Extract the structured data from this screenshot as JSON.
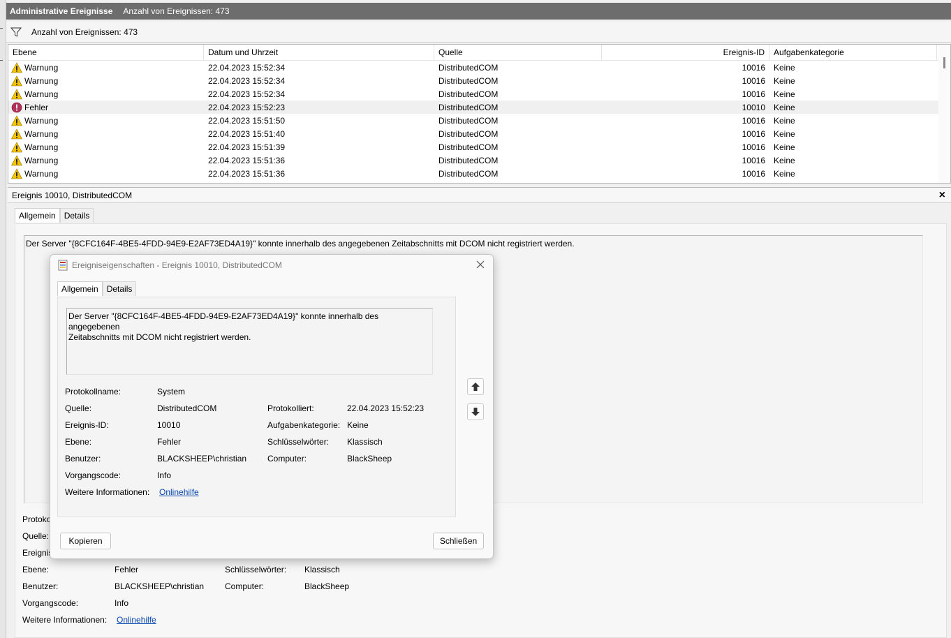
{
  "titlebar": {
    "title": "Administrative Ereignisse",
    "count": "Anzahl von Ereignissen: 473"
  },
  "filterbar": {
    "text": "Anzahl von Ereignissen: 473",
    "icon": "filter-icon"
  },
  "grid": {
    "columns": [
      "Ebene",
      "Datum und Uhrzeit",
      "Quelle",
      "Ereignis-ID",
      "Aufgabenkategorie"
    ],
    "rows": [
      {
        "level": "Warnung",
        "date": "22.04.2023 15:52:34",
        "source": "DistributedCOM",
        "id": "10016",
        "category": "Keine"
      },
      {
        "level": "Warnung",
        "date": "22.04.2023 15:52:34",
        "source": "DistributedCOM",
        "id": "10016",
        "category": "Keine"
      },
      {
        "level": "Warnung",
        "date": "22.04.2023 15:52:34",
        "source": "DistributedCOM",
        "id": "10016",
        "category": "Keine"
      },
      {
        "level": "Fehler",
        "date": "22.04.2023 15:52:23",
        "source": "DistributedCOM",
        "id": "10010",
        "category": "Keine"
      },
      {
        "level": "Warnung",
        "date": "22.04.2023 15:51:50",
        "source": "DistributedCOM",
        "id": "10016",
        "category": "Keine"
      },
      {
        "level": "Warnung",
        "date": "22.04.2023 15:51:40",
        "source": "DistributedCOM",
        "id": "10016",
        "category": "Keine"
      },
      {
        "level": "Warnung",
        "date": "22.04.2023 15:51:39",
        "source": "DistributedCOM",
        "id": "10016",
        "category": "Keine"
      },
      {
        "level": "Warnung",
        "date": "22.04.2023 15:51:36",
        "source": "DistributedCOM",
        "id": "10016",
        "category": "Keine"
      },
      {
        "level": "Warnung",
        "date": "22.04.2023 15:51:36",
        "source": "DistributedCOM",
        "id": "10016",
        "category": "Keine"
      }
    ]
  },
  "detail": {
    "header": "Ereignis 10010, DistributedCOM",
    "close": "×",
    "tabs": [
      "Allgemein",
      "Details"
    ],
    "message": "Der Server \"{8CFC164F-4BE5-4FDD-94E9-E2AF73ED4A19}\" konnte innerhalb des angegebenen Zeitabschnitts mit DCOM nicht registriert werden.",
    "labels": {
      "protokoll_partial": "Protoko",
      "quelle": "Quelle:",
      "ereignis_partial": "Ereignis",
      "ebene": "Ebene:",
      "benutzer": "Benutzer:",
      "vorgangscode": "Vorgangscode:",
      "weitere": "Weitere Informationen:",
      "schluessel": "Schlüsselwörter:",
      "computer": "Computer:"
    },
    "values": {
      "ebene": "Fehler",
      "benutzer": "BLACKSHEEP\\christian",
      "vorgangscode": "Info",
      "weitere": "Onlinehilfe",
      "schluessel": "Klassisch",
      "computer": "BlackSheep"
    }
  },
  "dialog": {
    "title": "Ereigniseigenschaften - Ereignis 10010, DistributedCOM",
    "tabs": [
      "Allgemein",
      "Details"
    ],
    "message_line1": "Der Server \"{8CFC164F-4BE5-4FDD-94E9-E2AF73ED4A19}\" konnte innerhalb des angegebenen",
    "message_line2": "Zeitabschnitts mit DCOM nicht registriert werden.",
    "fields": {
      "protokollname_label": "Protokollname:",
      "protokollname": "System",
      "quelle_label": "Quelle:",
      "quelle": "DistributedCOM",
      "protokolliert_label": "Protokolliert:",
      "protokolliert": "22.04.2023 15:52:23",
      "ereignisid_label": "Ereignis-ID:",
      "ereignisid": "10010",
      "aufgabe_label": "Aufgabenkategorie:",
      "aufgabe": "Keine",
      "ebene_label": "Ebene:",
      "ebene": "Fehler",
      "schluessel_label": "Schlüsselwörter:",
      "schluessel": "Klassisch",
      "benutzer_label": "Benutzer:",
      "benutzer": "BLACKSHEEP\\christian",
      "computer_label": "Computer:",
      "computer": "BlackSheep",
      "vorgang_label": "Vorgangscode:",
      "vorgang": "Info",
      "weitere_label": "Weitere Informationen:",
      "weitere": "Onlinehilfe"
    },
    "buttons": {
      "copy": "Kopieren",
      "close": "Schließen"
    }
  },
  "colors": {
    "titlebar": "#6d6d6d",
    "warning": "#f5c400",
    "error": "#b3305a",
    "link": "#0645ad"
  }
}
